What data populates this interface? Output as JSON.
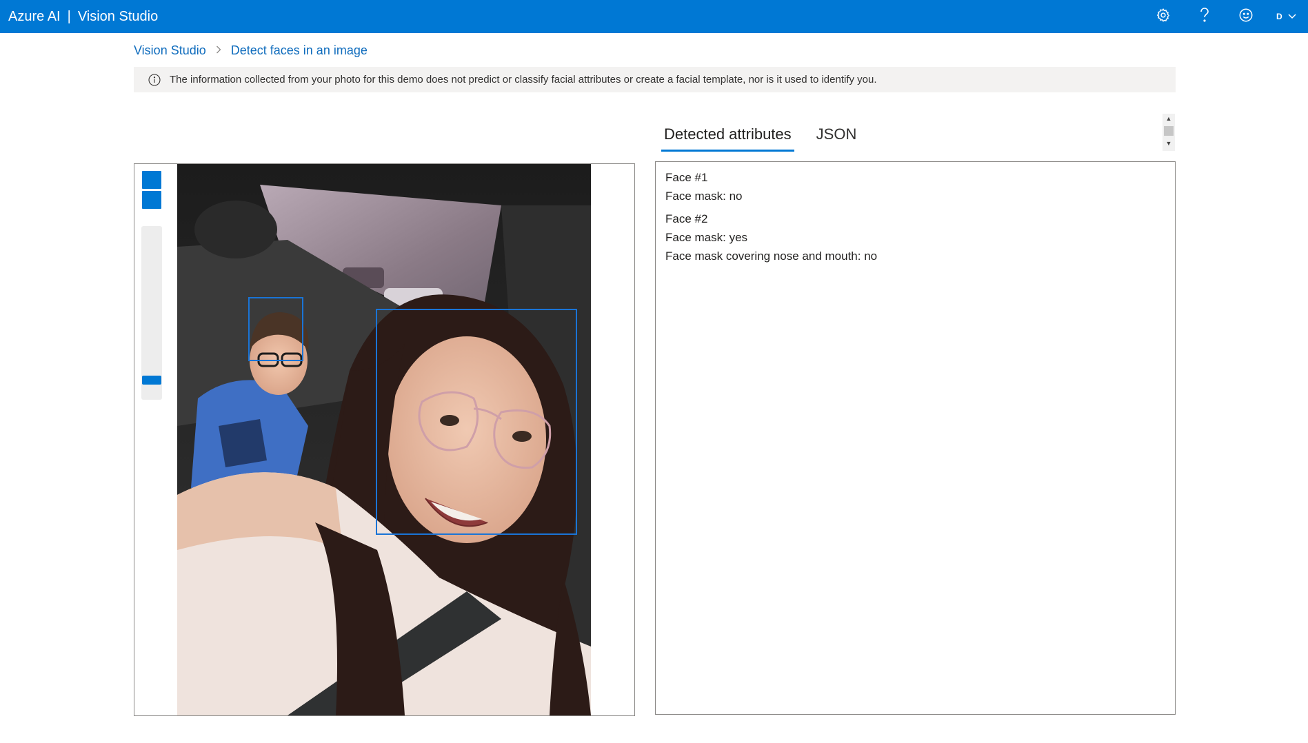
{
  "header": {
    "brand": "Azure AI",
    "separator": "|",
    "product": "Vision Studio",
    "avatar_initial": "D",
    "icons": [
      "gear-icon",
      "help-icon",
      "smiley-icon",
      "chevron-down-icon"
    ],
    "accent_color": "#0078d4"
  },
  "breadcrumb": {
    "root": "Vision Studio",
    "current": "Detect faces in an image"
  },
  "info": {
    "message": "The information collected from your photo for this demo does not predict or classify facial attributes or create a facial template, nor is it used to identify you."
  },
  "tabs": [
    {
      "label": "Detected attributes",
      "active": true
    },
    {
      "label": "JSON",
      "active": false
    }
  ],
  "zoom": {
    "level": 0.92,
    "icons": [
      "zoom-in-icon",
      "zoom-out-icon"
    ]
  },
  "results": {
    "faces": [
      {
        "title": "Face #1",
        "lines": [
          "Face mask: no"
        ]
      },
      {
        "title": "Face #2",
        "lines": [
          "Face mask: yes",
          "Face mask covering nose and mouth: no"
        ]
      }
    ]
  }
}
